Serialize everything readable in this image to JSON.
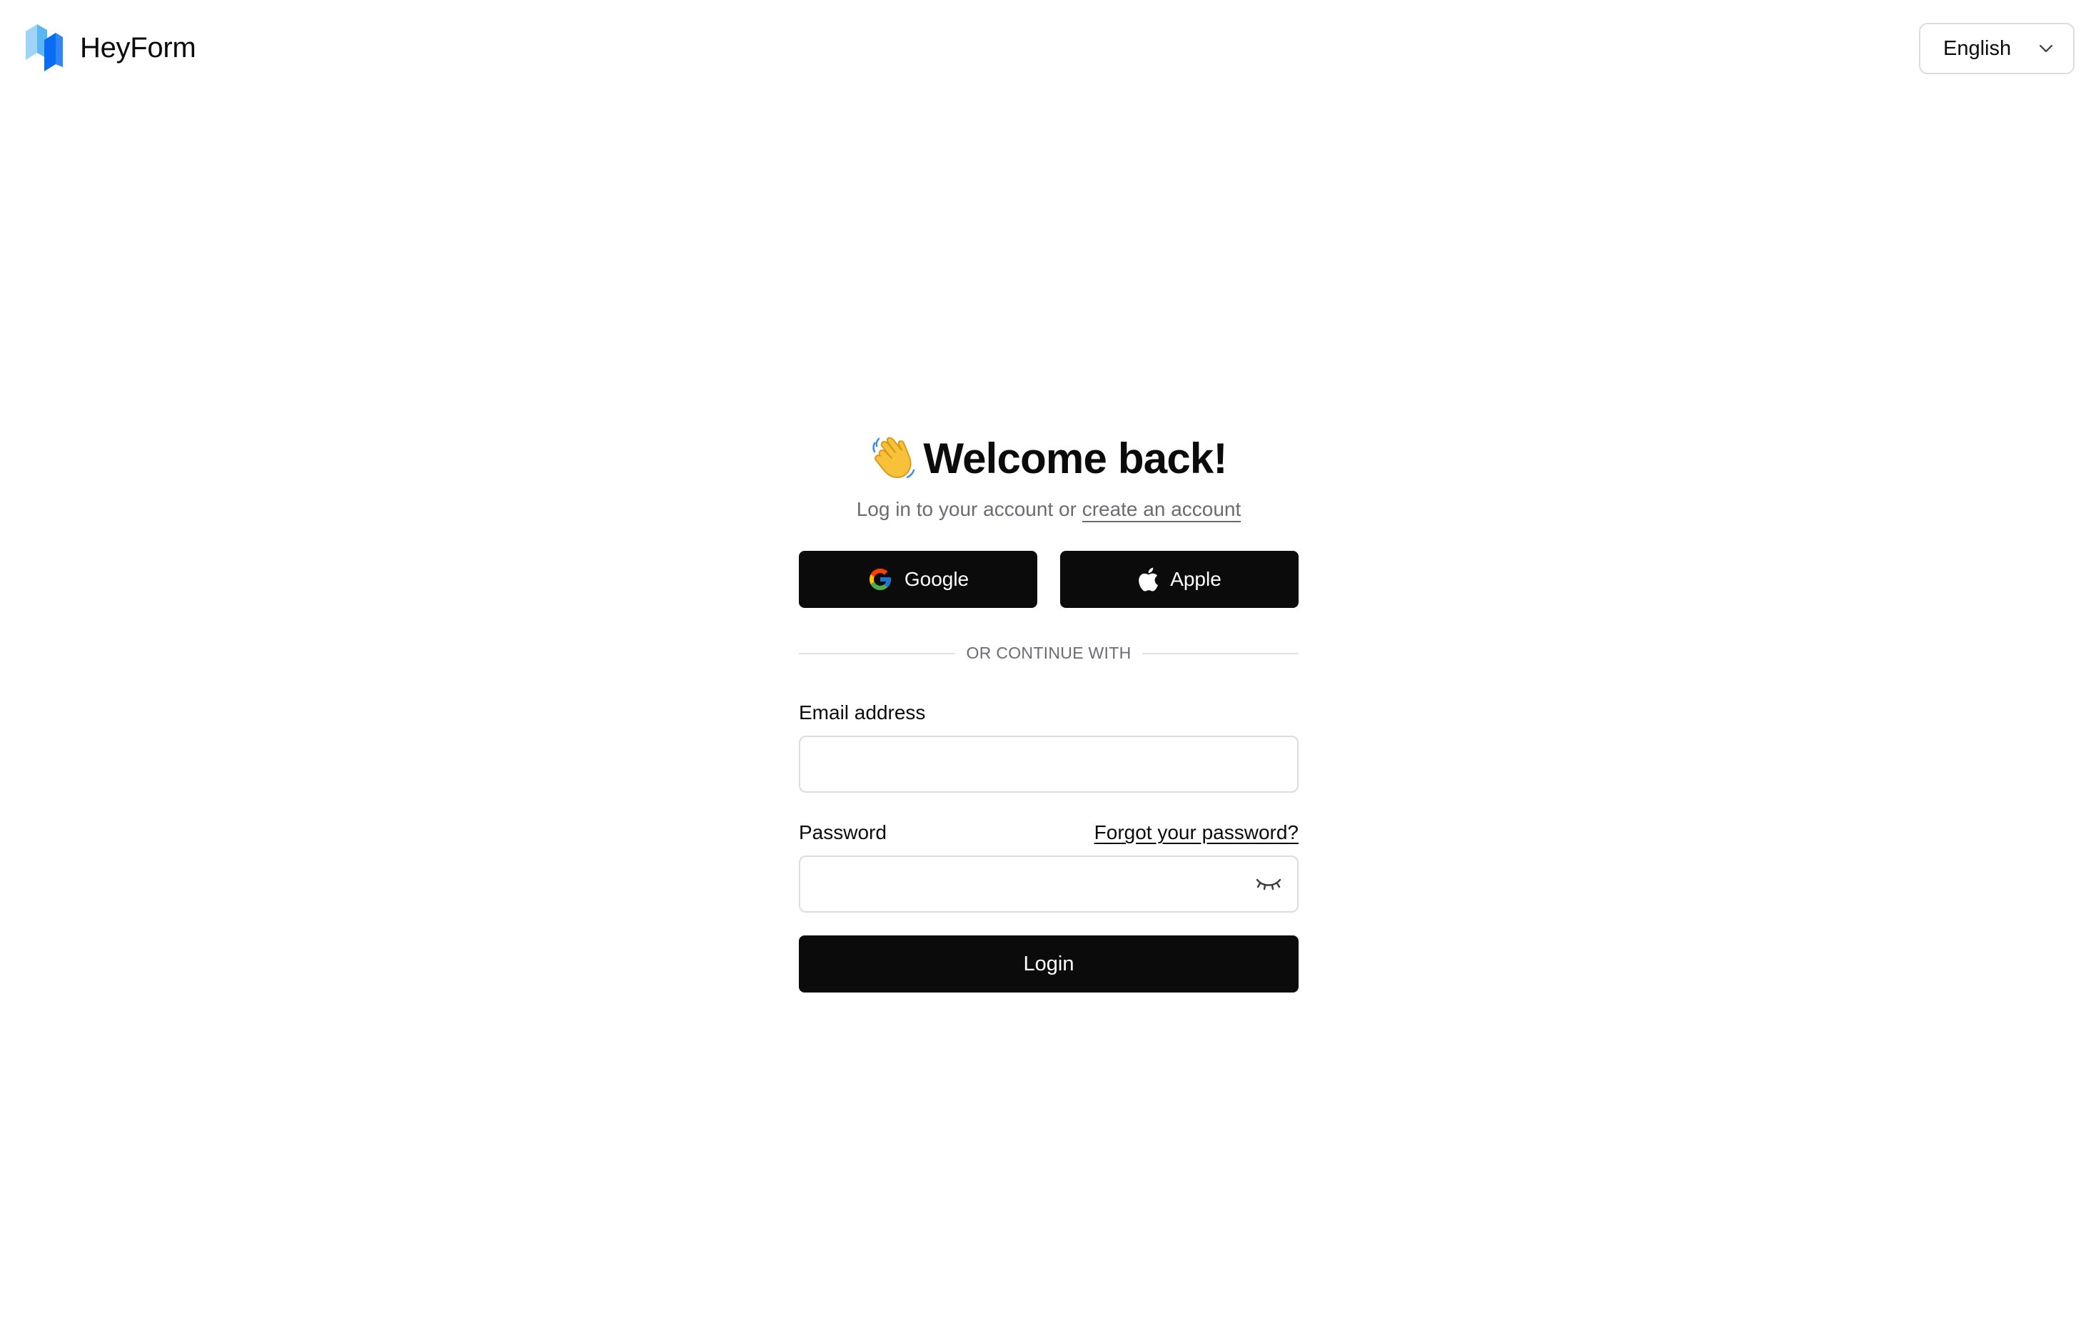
{
  "header": {
    "brand_name": "HeyForm",
    "logo_icon": "heyform-logo-icon",
    "language": {
      "selected": "English",
      "icon": "chevron-down-icon"
    }
  },
  "auth": {
    "title_icon": "waving-hand-icon",
    "title": "Welcome back!",
    "subtitle_prefix": "Log in to your account or ",
    "create_account_link": "create an account",
    "social_buttons": {
      "google": {
        "label": "Google",
        "icon": "google-icon"
      },
      "apple": {
        "label": "Apple",
        "icon": "apple-icon"
      }
    },
    "divider_text": "OR CONTINUE WITH",
    "email": {
      "label": "Email address",
      "value": "",
      "placeholder": ""
    },
    "password": {
      "label": "Password",
      "value": "",
      "placeholder": "",
      "toggle_icon": "eye-closed-icon"
    },
    "forgot_password_link": "Forgot your password?",
    "login_button": "Login"
  },
  "colors": {
    "primary_button": "#0b0b0c",
    "brand_blue": "#0a6cf2",
    "brand_light_blue": "#7cc4f5",
    "muted_text": "#6b6b73",
    "border": "#dcdce0"
  }
}
